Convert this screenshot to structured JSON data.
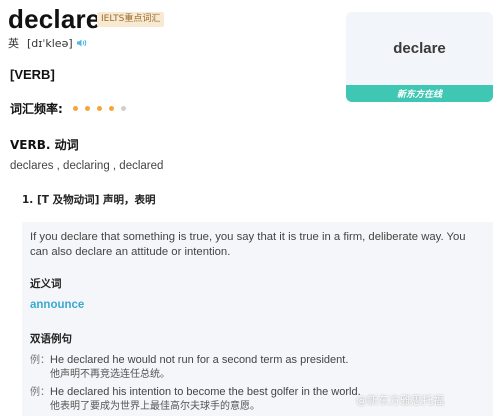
{
  "entry": {
    "word": "declare",
    "tag": "IELTS重点词汇",
    "phonetic_region": "英",
    "phonetic": "[dɪˈkleə]",
    "pos_heading": "[VERB]"
  },
  "card": {
    "word": "declare",
    "brand": "新东方在线"
  },
  "frequency": {
    "label": "词汇频率:",
    "level": 4,
    "max": 5
  },
  "definition_block": {
    "pos_title": "VERB. 动词",
    "forms": "declares , declaring , declared",
    "sense": "1. [T 及物动词] 声明，表明",
    "definition": "If you declare that something is true, you say that it is true in a firm, deliberate way. You can also declare an attitude or intention.",
    "synonyms_title": "近义词",
    "synonym": "announce",
    "examples_title": "双语例句",
    "examples": [
      {
        "mark": "例：",
        "en": "He declared he would not run for a second term as president.",
        "zh": "他声明不再竞选连任总统。"
      },
      {
        "mark": "例：",
        "en": "He declared his intention to become the best golfer in the world.",
        "zh": "他表明了要成为世界上最佳高尔夫球手的意愿。"
      }
    ]
  },
  "watermark": "@新东方雅思托福",
  "colors": {
    "accent_teal": "#3fc7b3",
    "link_blue": "#3aa9d2",
    "dot_on": "#f5a53a",
    "dot_off": "#cfcfcf",
    "tag_bg": "#f8ead2"
  }
}
